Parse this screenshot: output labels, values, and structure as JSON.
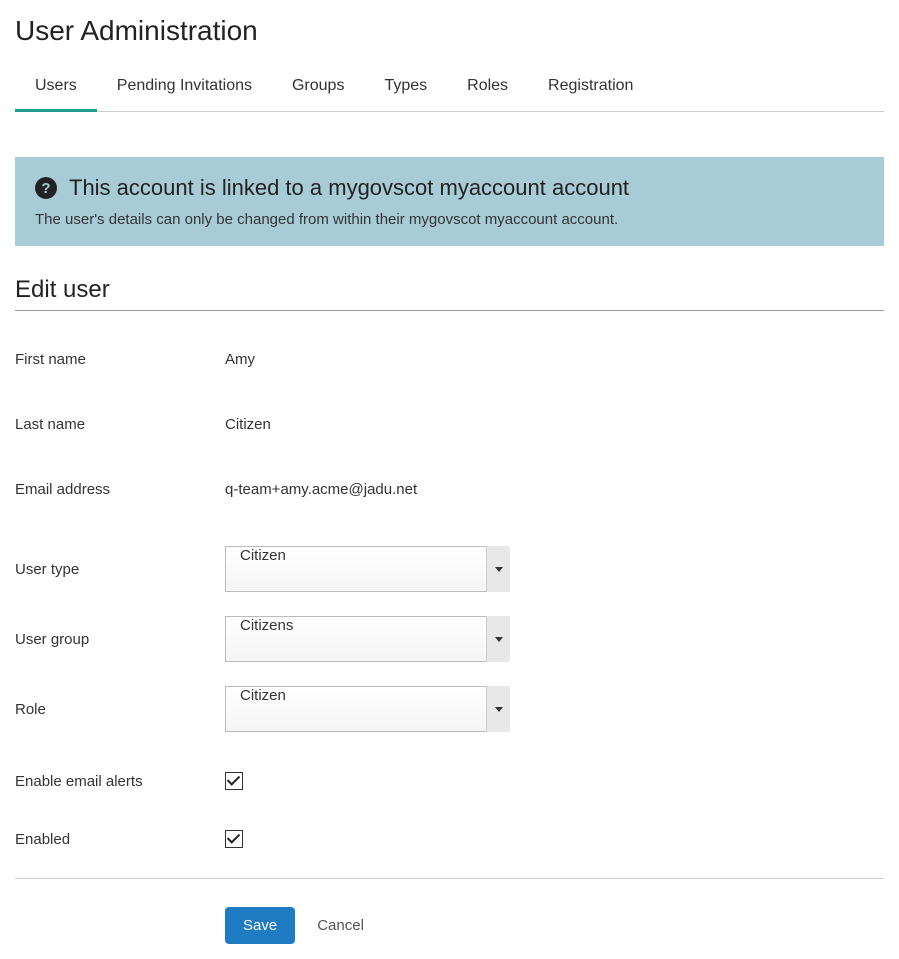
{
  "page_title": "User Administration",
  "tabs": [
    {
      "label": "Users",
      "active": true
    },
    {
      "label": "Pending Invitations",
      "active": false
    },
    {
      "label": "Groups",
      "active": false
    },
    {
      "label": "Types",
      "active": false
    },
    {
      "label": "Roles",
      "active": false
    },
    {
      "label": "Registration",
      "active": false
    }
  ],
  "alert": {
    "title": "This account is linked to a mygovscot myaccount account",
    "body": "The user's details can only be changed from within their mygovscot myaccount account."
  },
  "section_title": "Edit user",
  "fields": {
    "first_name": {
      "label": "First name",
      "value": "Amy"
    },
    "last_name": {
      "label": "Last name",
      "value": "Citizen"
    },
    "email": {
      "label": "Email address",
      "value": "q-team+amy.acme@jadu.net"
    },
    "user_type": {
      "label": "User type",
      "value": "Citizen"
    },
    "user_group": {
      "label": "User group",
      "value": "Citizens"
    },
    "role": {
      "label": "Role",
      "value": "Citizen"
    },
    "email_alerts": {
      "label": "Enable email alerts",
      "checked": true
    },
    "enabled": {
      "label": "Enabled",
      "checked": true
    }
  },
  "actions": {
    "save": "Save",
    "cancel": "Cancel"
  }
}
